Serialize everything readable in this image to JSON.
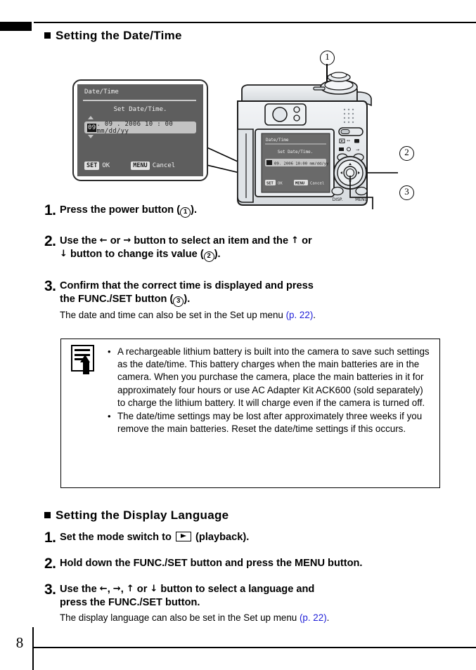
{
  "page": {
    "number": "8"
  },
  "sections": [
    {
      "heading": "Setting the Date/Time"
    },
    {
      "heading": "Setting the Display Language"
    }
  ],
  "datetime_steps": [
    {
      "num": "1.",
      "text_before": "Press the power button (",
      "callout": "1",
      "text_after": ")."
    },
    {
      "num": "2.",
      "line1_a": "Use the ",
      "arrow_left": "←",
      "line1_b": " or ",
      "arrow_right": "→",
      "line1_c": " button to select an item and the ",
      "arrow_up": "↑",
      "line1_d": " or",
      "arrow_down": "↓",
      "line2_a": " button to change its value (",
      "callout": "2",
      "line2_b": ")."
    },
    {
      "num": "3.",
      "line1": "Confirm that the correct time is displayed and press",
      "line2_a": "the FUNC./SET button (",
      "callout": "3",
      "line2_b": ").",
      "sub_a": "The date and time can also be set in the Set up menu ",
      "sub_ref": "(p. 22)",
      "sub_b": "."
    }
  ],
  "language_steps": [
    {
      "num": "1.",
      "text_a": "Set the mode switch to ",
      "icon": "playback-icon",
      "text_b": " (playback)."
    },
    {
      "num": "2.",
      "text": "Hold down the FUNC./SET button and press the MENU button."
    },
    {
      "num": "3.",
      "line1_a": "Use the ",
      "arrow_left": "←",
      "sep1": ", ",
      "arrow_right": "→",
      "sep2": ", ",
      "arrow_up": "↑",
      "line1_b": " or ",
      "arrow_down": "↓",
      "line1_c": " button to select a language and",
      "line2": "press the FUNC./SET button.",
      "sub_a": "The display language can also be set in the Set up menu ",
      "sub_ref": "(p. 22)",
      "sub_b": "."
    }
  ],
  "note_box": {
    "icon": "note-pencil-icon",
    "items": [
      "A rechargeable lithium battery is built into the camera to save such settings as the date/time. This battery charges when the main batteries are in the camera. When you purchase the camera, place the main batteries in it for approximately four hours or use AC Adapter Kit ACK600 (sold separately) to charge the lithium battery. It will charge even if the camera is turned off.",
      "The date/time settings may be lost after approximately three weeks if you remove the main batteries. Reset the date/time settings if this occurs."
    ],
    "bullet": "•"
  },
  "lcd_screen": {
    "title": "Date/Time",
    "subtitle": "Set Date/Time.",
    "field_selected": "09",
    "field_rest": ". 09 . 2006 10 : 00 mm/dd/yy",
    "set_key": "SET",
    "set_label": "OK",
    "menu_key": "MENU",
    "menu_label": "Cancel"
  },
  "camera": {
    "callouts": [
      {
        "id": "1",
        "label": "1",
        "target": "power-button"
      },
      {
        "id": "2",
        "label": "2",
        "target": "four-way-control"
      },
      {
        "id": "3",
        "label": "3",
        "target": "func-set-button"
      }
    ],
    "mini_lcd": {
      "title": "Date/Time",
      "subtitle": "Set Date/Time.",
      "field": "09. 2006 10:00 mm/dd/yy",
      "set_key": "SET",
      "set_label": "OK",
      "menu_key": "MENU",
      "menu_label": "Cancel"
    },
    "button_labels": {
      "disp": "DISP.",
      "menu": "MENU"
    }
  },
  "colors": {
    "page_ref_blue": "#2020d8",
    "lcd_background": "#5e5e5e",
    "lcd_field": "#c3c3c3",
    "camera_body": "#e4e7ea",
    "ink": "#000000"
  }
}
